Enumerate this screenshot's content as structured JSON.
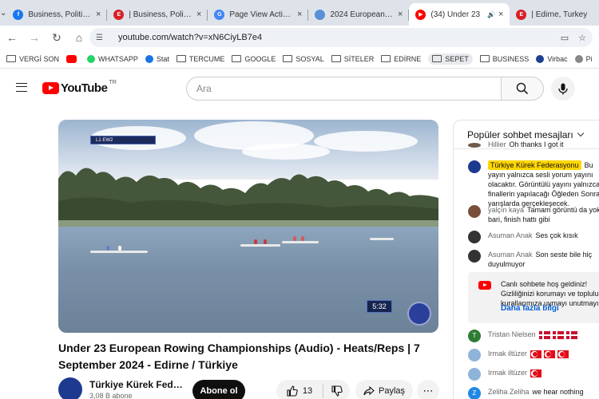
{
  "browser": {
    "tabs": [
      {
        "title": "Business, Politics, T",
        "fav_bg": "#1877f2",
        "fav_glyph": "f",
        "active": false
      },
      {
        "title": "| Business, Politics, T",
        "fav_bg": "#d91f26",
        "fav_glyph": "E",
        "active": false
      },
      {
        "title": "Page View Activity",
        "fav_bg": "#4285f4",
        "fav_glyph": "G",
        "active": false
      },
      {
        "title": "2024 European Ro",
        "fav_bg": "#5b8fd6",
        "fav_glyph": "",
        "active": false
      },
      {
        "title": "(34) Under 23",
        "fav_bg": "#ff0000",
        "fav_glyph": "▶",
        "active": true
      },
      {
        "title": "| Edirne, Turkey",
        "fav_bg": "#d91f26",
        "fav_glyph": "E",
        "active": false
      }
    ],
    "url": "youtube.com/watch?v=xN6CiyLB7e4",
    "bookmarks": [
      {
        "label": "VERGİ SON",
        "kind": "folder"
      },
      {
        "label": "",
        "kind": "youtube"
      },
      {
        "label": "WHATSAPP",
        "kind": "whatsapp"
      },
      {
        "label": "Stat",
        "kind": "stat"
      },
      {
        "label": "TERCUME",
        "kind": "folder"
      },
      {
        "label": "GOOGLE",
        "kind": "folder"
      },
      {
        "label": "SOSYAL",
        "kind": "folder"
      },
      {
        "label": "SİTELER",
        "kind": "folder"
      },
      {
        "label": "EDİRNE",
        "kind": "folder"
      },
      {
        "label": "SEPET",
        "kind": "folder"
      },
      {
        "label": "BUSINESS",
        "kind": "folder"
      },
      {
        "label": "Virbac",
        "kind": "virbac"
      },
      {
        "label": "Pi",
        "kind": "other"
      }
    ]
  },
  "youtube": {
    "logo_text": "YouTube",
    "country_code": "TR",
    "search_placeholder": "Ara"
  },
  "video": {
    "overlay_label": "L1  EW2",
    "time": "5:32",
    "title": "Under 23 European Rowing Championships (Audio) - Heats/Reps | 7 September 2024 - Edirne / Türkiye",
    "channel_name": "Türkiye Kürek Federasyonu",
    "subscribers": "3,08 B abone",
    "subscribe_label": "Abone ol",
    "likes": "13",
    "share_label": "Paylaş"
  },
  "chat": {
    "header": "Popüler sohbet mesajları",
    "messages": [
      {
        "author": "Hillier",
        "text": "Oh thanks I got it",
        "owner": false,
        "avatar": "#6d5a4b"
      },
      {
        "author": "Türkiye Kürek Federasyonu",
        "text": "Bu yayın yalnızca sesli yorum yayını olacaktır. Görüntülü yayını yalnızca A finallerin yapılacağı Öğleden Sonraki yarışlarda gerçekleşecek.",
        "owner": true,
        "avatar": "#1e3a8f"
      },
      {
        "author": "yalçın kaya",
        "text": "Tamam görüntü da yok bari, finish hattı gibi",
        "owner": false,
        "avatar": "#7a4f3a"
      },
      {
        "author": "Asuman Anak",
        "text": "Ses çok kısık",
        "owner": false,
        "avatar": "#333333"
      },
      {
        "author": "Asuman Anak",
        "text": "Son seste bile hiç duyulmuyor",
        "owner": false,
        "avatar": "#333333"
      },
      {
        "author": "Tristan Nielsen",
        "text": "",
        "flags": "dk",
        "owner": false,
        "avatar": "#2e7d32",
        "initial": "T"
      },
      {
        "author": "Irmak iltüzer",
        "text": "",
        "flags": "tr3",
        "owner": false,
        "avatar": "#8fb3d9"
      },
      {
        "author": "Irmak iltüzer",
        "text": "",
        "flags": "tr1",
        "owner": false,
        "avatar": "#8fb3d9"
      },
      {
        "author": "Zeliha Zeliha",
        "text": "we hear nothing",
        "owner": false,
        "avatar": "#1e88e5",
        "initial": "Z"
      }
    ],
    "welcome_text": "Canlı sohbete hoş geldiniz! Gizliliğinizi korumayı ve topluluk kurallarımıza uymayı unutmayın.",
    "welcome_link": "Daha fazla bilgi"
  }
}
